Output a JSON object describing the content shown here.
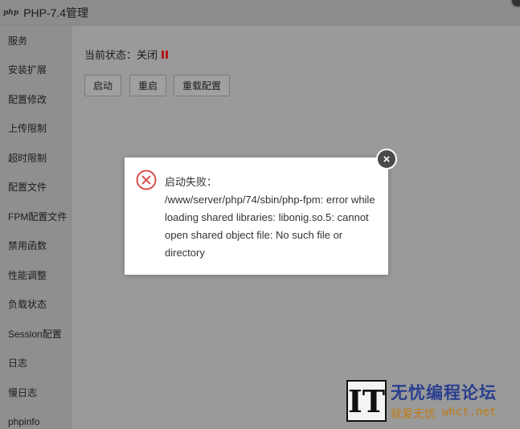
{
  "window": {
    "logo": "php",
    "title": "PHP-7.4管理"
  },
  "sidebar": {
    "items": [
      {
        "label": "服务"
      },
      {
        "label": "安装扩展"
      },
      {
        "label": "配置修改"
      },
      {
        "label": "上传限制"
      },
      {
        "label": "超时限制"
      },
      {
        "label": "配置文件"
      },
      {
        "label": "FPM配置文件"
      },
      {
        "label": "禁用函数"
      },
      {
        "label": "性能调整"
      },
      {
        "label": "负载状态"
      },
      {
        "label": "Session配置"
      },
      {
        "label": "日志"
      },
      {
        "label": "慢日志"
      },
      {
        "label": "phpinfo"
      }
    ]
  },
  "main": {
    "status_label": "当前状态：关闭",
    "buttons": {
      "start": "启动",
      "restart": "重启",
      "reload": "重载配置"
    }
  },
  "dialog": {
    "title": "启动失败：",
    "message": "/www/server/php/74/sbin/php-fpm: error while loading shared libraries: libonig.so.5: cannot open shared object file: No such file or directory",
    "close_glyph": "×"
  },
  "watermark": {
    "logo_text": "IT",
    "line1": "无忧编程论坛",
    "line2_cn": "就爱无忧",
    "line2_url": "whct.net"
  },
  "colors": {
    "error_red": "#d9534f",
    "status_stop": "#b01818",
    "overlay": "#7e7e7e"
  }
}
